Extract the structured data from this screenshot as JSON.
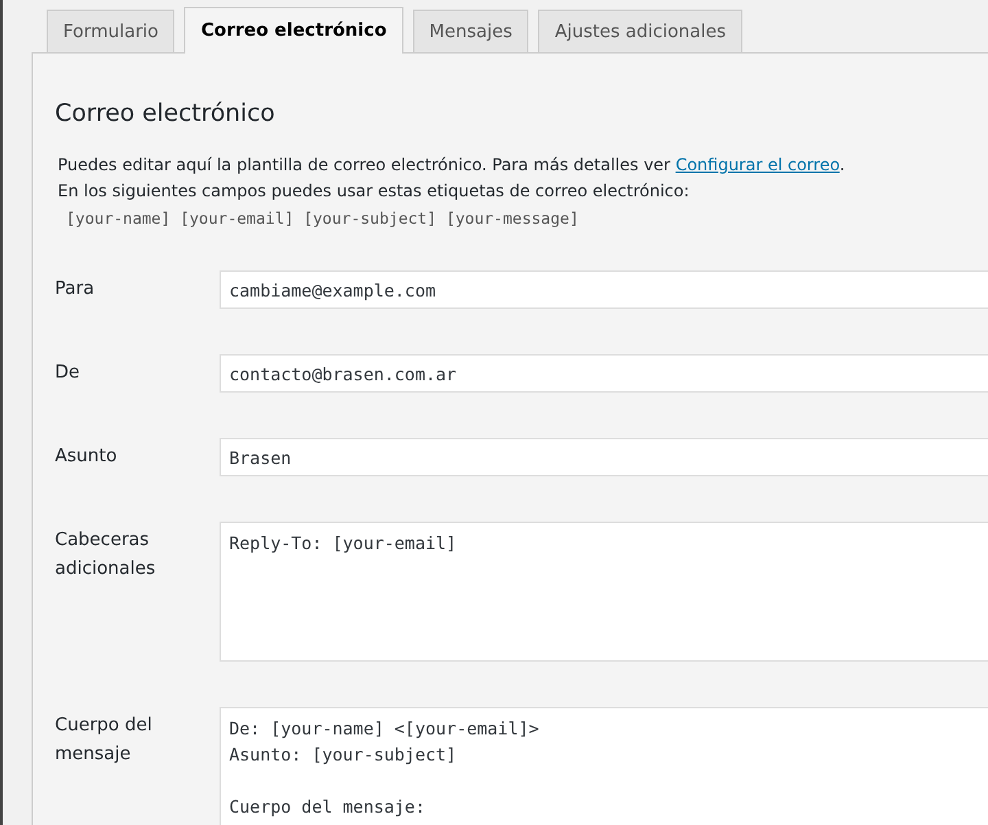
{
  "tabs": [
    {
      "label": "Formulario",
      "selected": false
    },
    {
      "label": "Correo electrónico",
      "selected": true
    },
    {
      "label": "Mensajes",
      "selected": false
    },
    {
      "label": "Ajustes adicionales",
      "selected": false
    }
  ],
  "panel": {
    "heading": "Correo electrónico",
    "intro": {
      "text": "Puedes editar aquí la plantilla de correo electrónico. Para más detalles ver",
      "link": "Configurar el correo",
      "after": "."
    },
    "note": "En los siguientes campos puedes usar estas etiquetas de correo electrónico:",
    "tags": "[your-name] [your-email] [your-subject] [your-message]",
    "fields": [
      {
        "label": "Para",
        "kind": "line",
        "value": "cambiame@example.com"
      },
      {
        "label": "De",
        "kind": "line",
        "value": "contacto@brasen.com.ar"
      },
      {
        "label": "Asunto",
        "kind": "line",
        "value": "Brasen"
      },
      {
        "label": "Cabeceras adicionales",
        "kind": "area",
        "value": "Reply-To: [your-email]"
      },
      {
        "label": "Cuerpo del mensaje",
        "kind": "tall",
        "value": "De: [your-name] <[your-email]>\nAsunto: [your-subject]\n\nCuerpo del mensaje:"
      }
    ]
  }
}
